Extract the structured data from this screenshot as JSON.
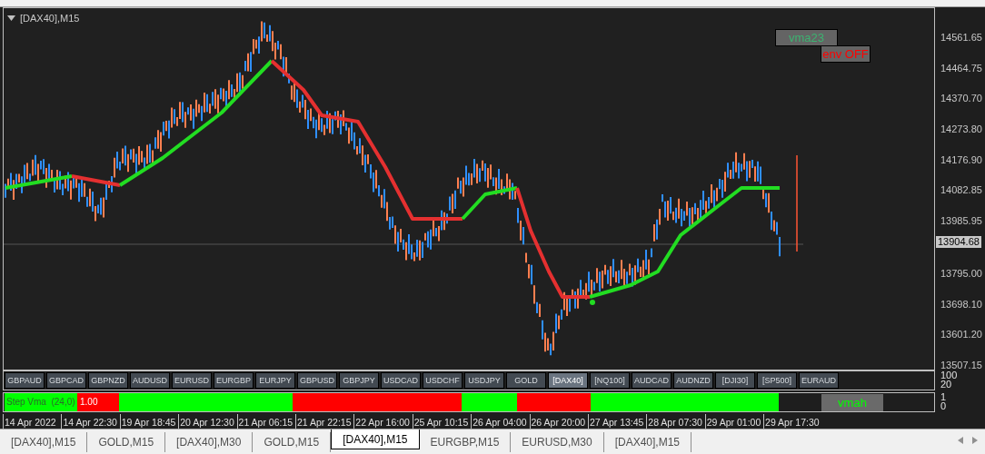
{
  "chart": {
    "title": "[DAX40],M15",
    "toggles": [
      {
        "label": "vma23",
        "on": true
      },
      {
        "label": "env OFF",
        "on": false
      }
    ]
  },
  "price_axis": [
    "14561.65",
    "14464.75",
    "14370.70",
    "14273.80",
    "14176.90",
    "14082.85",
    "13985.95",
    "13904.68",
    "13795.00",
    "13698.10",
    "13601.20",
    "13507.15"
  ],
  "symbols": [
    {
      "label": "GBPAUD",
      "selected": false
    },
    {
      "label": "GBPCAD",
      "selected": false
    },
    {
      "label": "GBPNZD",
      "selected": false
    },
    {
      "label": "AUDUSD",
      "selected": false
    },
    {
      "label": "EURUSD",
      "selected": false
    },
    {
      "label": "EURGBP",
      "selected": false
    },
    {
      "label": "EURJPY",
      "selected": false
    },
    {
      "label": "GBPUSD",
      "selected": false
    },
    {
      "label": "GBPJPY",
      "selected": false
    },
    {
      "label": "USDCAD",
      "selected": false
    },
    {
      "label": "USDCHF",
      "selected": false
    },
    {
      "label": "USDJPY",
      "selected": false
    },
    {
      "label": "GOLD",
      "selected": false
    },
    {
      "label": "[DAX40]",
      "selected": true
    },
    {
      "label": "[NQ100]",
      "selected": false
    },
    {
      "label": "AUDCAD",
      "selected": false
    },
    {
      "label": "AUDNZD",
      "selected": false
    },
    {
      "label": "[DJI30]",
      "selected": false
    },
    {
      "label": "[SP500]",
      "selected": false
    },
    {
      "label": "EURAUD",
      "selected": false
    }
  ],
  "symbol_axis": [
    "100",
    "20"
  ],
  "indicator": {
    "label": "Step Vma  (24,0)",
    "value": "1.00",
    "button": "vmah",
    "axis": [
      "1",
      "0"
    ]
  },
  "time_axis": [
    "14 Apr 2022",
    "14 Apr 22:30",
    "19 Apr 18:45",
    "20 Apr 12:30",
    "21 Apr 06:15",
    "21 Apr 22:15",
    "22 Apr 16:00",
    "25 Apr 10:15",
    "26 Apr 04:00",
    "26 Apr 20:00",
    "27 Apr 13:45",
    "28 Apr 07:30",
    "29 Apr 01:00",
    "29 Apr 17:30"
  ],
  "tabs": [
    {
      "label": "[DAX40],M15",
      "selected": false
    },
    {
      "label": "GOLD,M15",
      "selected": false
    },
    {
      "label": "[DAX40],M30",
      "selected": false
    },
    {
      "label": "GOLD,M15",
      "selected": false
    },
    {
      "label": "[DAX40],M15",
      "selected": true
    },
    {
      "label": "EURGBP,M15",
      "selected": false
    },
    {
      "label": "EURUSD,M30",
      "selected": false
    },
    {
      "label": "[DAX40],M15",
      "selected": false
    }
  ]
}
